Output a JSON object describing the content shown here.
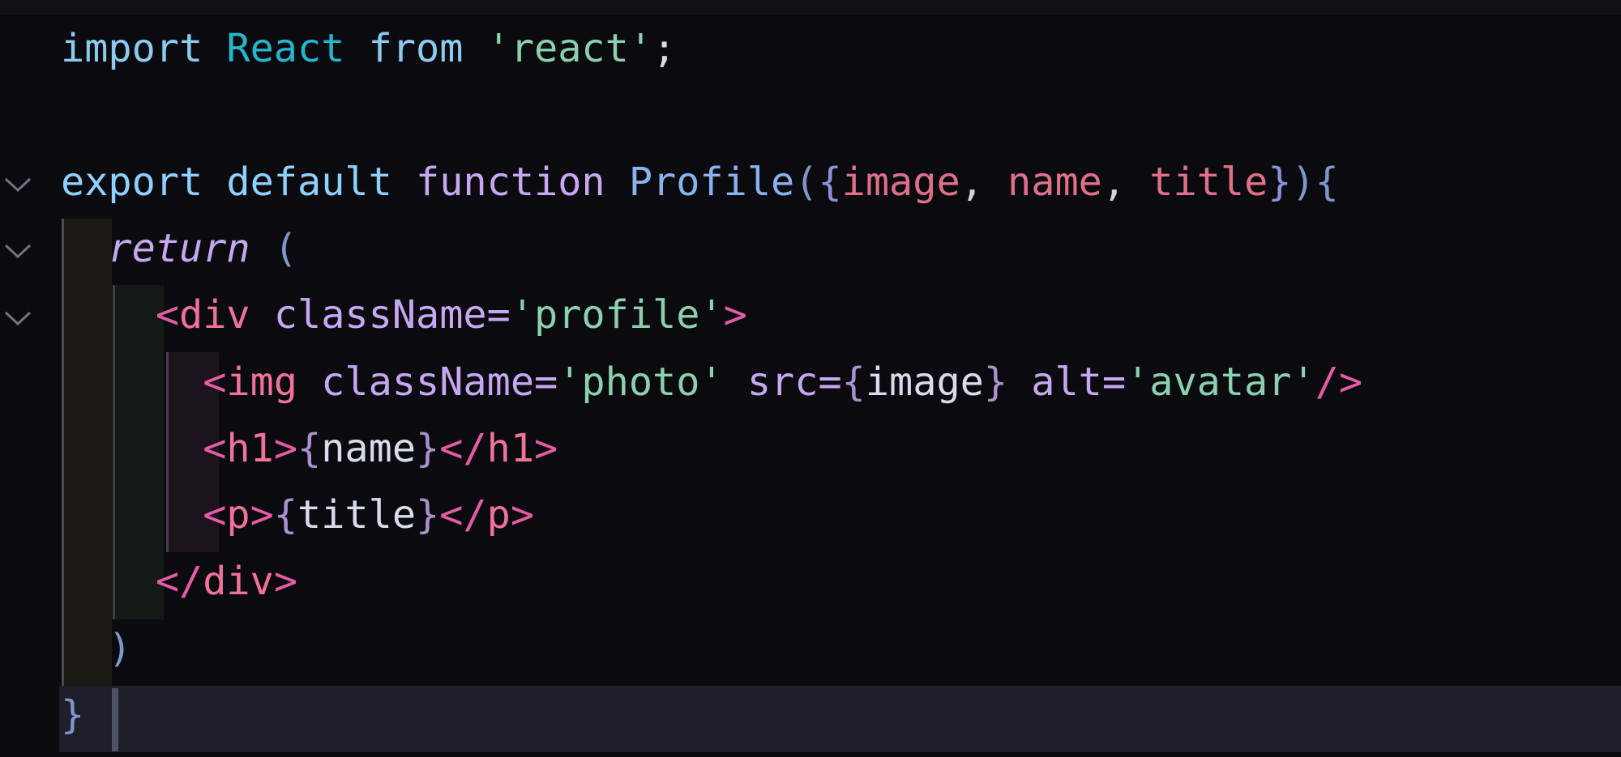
{
  "editor": {
    "language": "jsx",
    "active_line": 11,
    "lines": [
      {
        "tokens": [
          {
            "t": "import",
            "c": "kw-import"
          },
          {
            "t": " ",
            "c": ""
          },
          {
            "t": "React",
            "c": "ident-react"
          },
          {
            "t": " ",
            "c": ""
          },
          {
            "t": "from",
            "c": "kw-import"
          },
          {
            "t": " ",
            "c": ""
          },
          {
            "t": "'react'",
            "c": "str"
          },
          {
            "t": ";",
            "c": "punc-light"
          }
        ]
      },
      {
        "tokens": []
      },
      {
        "tokens": [
          {
            "t": "export",
            "c": "kw-export"
          },
          {
            "t": " ",
            "c": ""
          },
          {
            "t": "default",
            "c": "kw-export"
          },
          {
            "t": " ",
            "c": ""
          },
          {
            "t": "function",
            "c": "kw-fn"
          },
          {
            "t": " ",
            "c": ""
          },
          {
            "t": "Profile",
            "c": "fn-name"
          },
          {
            "t": "(",
            "c": "paren"
          },
          {
            "t": "{",
            "c": "brace"
          },
          {
            "t": "image",
            "c": "param"
          },
          {
            "t": ", ",
            "c": "white"
          },
          {
            "t": "name",
            "c": "param"
          },
          {
            "t": ", ",
            "c": "white"
          },
          {
            "t": "title",
            "c": "param"
          },
          {
            "t": "}",
            "c": "brace"
          },
          {
            "t": ")",
            "c": "paren"
          },
          {
            "t": "{",
            "c": "paren"
          }
        ]
      },
      {
        "tokens": [
          {
            "t": "  ",
            "c": ""
          },
          {
            "t": "return",
            "c": "kw-return"
          },
          {
            "t": " ",
            "c": ""
          },
          {
            "t": "(",
            "c": "paren"
          }
        ]
      },
      {
        "tokens": [
          {
            "t": "    ",
            "c": ""
          },
          {
            "t": "<",
            "c": "tag-punc"
          },
          {
            "t": "div",
            "c": "tag-name"
          },
          {
            "t": " ",
            "c": ""
          },
          {
            "t": "className",
            "c": "attr"
          },
          {
            "t": "=",
            "c": "attr"
          },
          {
            "t": "'profile'",
            "c": "str"
          },
          {
            "t": ">",
            "c": "tag-punc"
          }
        ]
      },
      {
        "tokens": [
          {
            "t": "      ",
            "c": ""
          },
          {
            "t": "<",
            "c": "tag-punc"
          },
          {
            "t": "img",
            "c": "tag-name"
          },
          {
            "t": " ",
            "c": ""
          },
          {
            "t": "className",
            "c": "attr"
          },
          {
            "t": "=",
            "c": "attr"
          },
          {
            "t": "'photo'",
            "c": "str"
          },
          {
            "t": " ",
            "c": ""
          },
          {
            "t": "src",
            "c": "attr"
          },
          {
            "t": "=",
            "c": "attr"
          },
          {
            "t": "{",
            "c": "jsx-brace"
          },
          {
            "t": "image",
            "c": "jsx-expr"
          },
          {
            "t": "}",
            "c": "jsx-brace"
          },
          {
            "t": " ",
            "c": ""
          },
          {
            "t": "alt",
            "c": "attr"
          },
          {
            "t": "=",
            "c": "attr"
          },
          {
            "t": "'avatar'",
            "c": "str"
          },
          {
            "t": "/>",
            "c": "tag-punc"
          }
        ]
      },
      {
        "tokens": [
          {
            "t": "      ",
            "c": ""
          },
          {
            "t": "<",
            "c": "tag-punc"
          },
          {
            "t": "h1",
            "c": "tag-name"
          },
          {
            "t": ">",
            "c": "tag-punc"
          },
          {
            "t": "{",
            "c": "jsx-brace"
          },
          {
            "t": "name",
            "c": "jsx-expr"
          },
          {
            "t": "}",
            "c": "jsx-brace"
          },
          {
            "t": "</",
            "c": "tag-punc"
          },
          {
            "t": "h1",
            "c": "tag-name"
          },
          {
            "t": ">",
            "c": "tag-punc"
          }
        ]
      },
      {
        "tokens": [
          {
            "t": "      ",
            "c": ""
          },
          {
            "t": "<",
            "c": "tag-punc"
          },
          {
            "t": "p",
            "c": "tag-name"
          },
          {
            "t": ">",
            "c": "tag-punc"
          },
          {
            "t": "{",
            "c": "jsx-brace"
          },
          {
            "t": "title",
            "c": "jsx-expr"
          },
          {
            "t": "}",
            "c": "jsx-brace"
          },
          {
            "t": "</",
            "c": "tag-punc"
          },
          {
            "t": "p",
            "c": "tag-name"
          },
          {
            "t": ">",
            "c": "tag-punc"
          }
        ]
      },
      {
        "tokens": [
          {
            "t": "    ",
            "c": ""
          },
          {
            "t": "</",
            "c": "tag-punc"
          },
          {
            "t": "div",
            "c": "tag-name"
          },
          {
            "t": ">",
            "c": "tag-punc"
          }
        ]
      },
      {
        "tokens": [
          {
            "t": "  ",
            "c": ""
          },
          {
            "t": ")",
            "c": "paren"
          }
        ]
      },
      {
        "tokens": [
          {
            "t": "}",
            "c": "paren"
          }
        ]
      }
    ],
    "fold_icons": [
      {
        "line": 3,
        "icon": "chevron-down-icon"
      },
      {
        "line": 4,
        "icon": "chevron-down-icon"
      },
      {
        "line": 5,
        "icon": "chevron-down-icon"
      }
    ],
    "colors": {
      "background": "#0b0b0f",
      "active_line": "#1e1f2b",
      "string": "#8dd0ad",
      "keyword": "#8fd0ff",
      "tag": "#f0729a",
      "param": "#e0708a",
      "attribute": "#c7a7f2"
    }
  }
}
